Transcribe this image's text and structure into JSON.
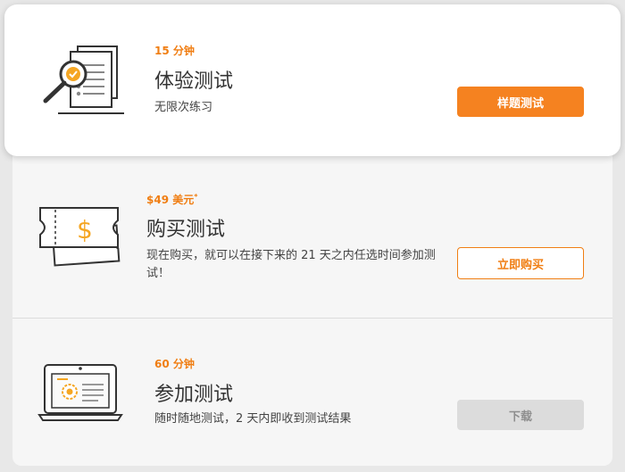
{
  "cards": [
    {
      "meta": "15 分钟",
      "title": "体验测试",
      "description": "无限次练习",
      "button_label": "样题测试",
      "icon": "document-magnifier-icon"
    },
    {
      "meta": "$49 美元",
      "meta_suffix": "*",
      "title": "购买测试",
      "description": "现在购买，就可以在接下来的 21 天之内任选时间参加测试！",
      "button_label": "立即购买",
      "icon": "ticket-dollar-icon"
    },
    {
      "meta": "60 分钟",
      "title": "参加测试",
      "description": "随时随地测试，2 天内即收到测试结果",
      "button_label": "下载",
      "icon": "laptop-certificate-icon"
    }
  ],
  "colors": {
    "accent": "#f58220",
    "meta_text": "#f07e13",
    "disabled_button": "#dcdcdc",
    "card_background": "#ffffff",
    "panel_background": "#f6f6f6"
  }
}
